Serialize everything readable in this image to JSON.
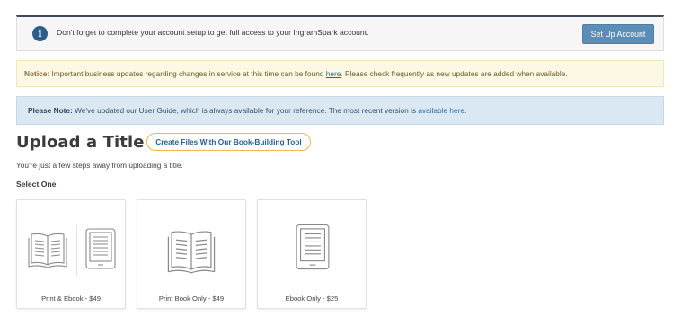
{
  "setup_banner": {
    "icon": "info-icon",
    "message": "Don't forget to complete your account setup to get full access to your IngramSpark account.",
    "button_label": "Set Up Account"
  },
  "notice": {
    "label": "Notice:",
    "text_before": " Important business updates regarding changes in service at this time can be found ",
    "link": "here",
    "text_after": ". Please check frequently as new updates are added when available."
  },
  "note": {
    "label": "Please Note:",
    "text": " We've updated our User Guide, which is always available for your reference. The most recent version is ",
    "link": "available here",
    "text_after": "."
  },
  "page": {
    "title": "Upload a Title",
    "tool_button": "Create Files With Our Book-Building Tool",
    "subtitle": "You're just a few steps away from uploading a title.",
    "select_label": "Select One"
  },
  "options": [
    {
      "label": "Print & Ebook - $49",
      "icons": [
        "open-book-icon",
        "ereader-icon"
      ]
    },
    {
      "label": "Print Book Only - $49",
      "icons": [
        "open-book-icon"
      ]
    },
    {
      "label": "Ebook Only - $25",
      "icons": [
        "ereader-icon"
      ]
    }
  ],
  "colors": {
    "banner_border_top": "#3d4a5a",
    "button_blue": "#5b8db6",
    "notice_bg": "#fcf8e3",
    "note_bg": "#d9e8f3",
    "tool_button_border": "#f0b94e",
    "link": "#2a6496"
  }
}
